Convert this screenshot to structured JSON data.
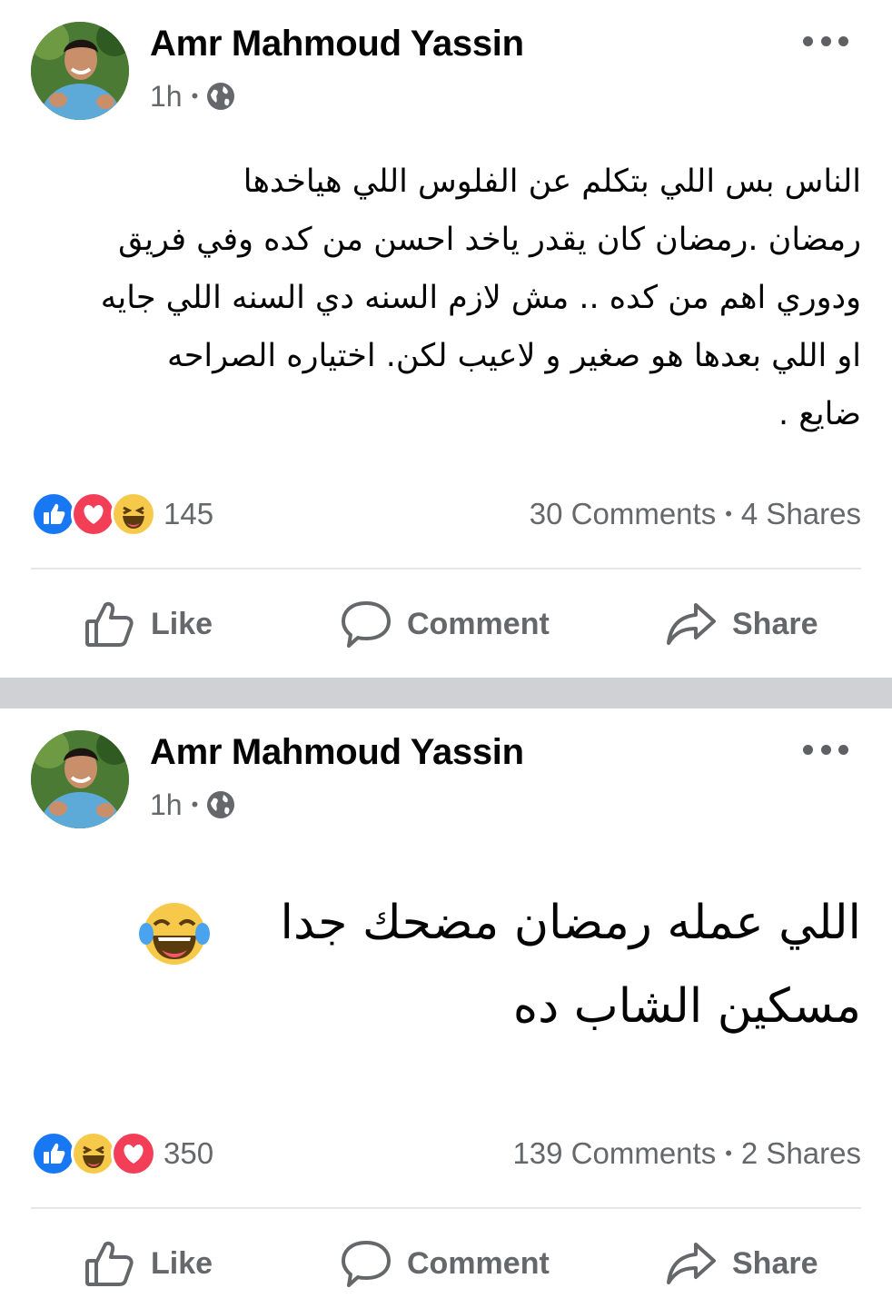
{
  "posts": [
    {
      "author": "Amr Mahmoud Yassin",
      "time": "1h",
      "privacy_icon": "globe-icon",
      "text_lines": [
        "الناس بس اللي بتكلم عن الفلوس اللي هياخدها",
        "رمضان .رمضان كان يقدر ياخد احسن من كده وفي فريق",
        "ودوري اهم من كده .. مش لازم السنه دي السنه اللي جايه",
        "او اللي بعدها هو صغير و لاعيب لكن. اختياره الصراحه",
        "ضايع ."
      ],
      "reactions": [
        "like",
        "love",
        "haha"
      ],
      "reaction_count": "145",
      "comments": "30 Comments",
      "shares": "4 Shares"
    },
    {
      "author": "Amr Mahmoud Yassin",
      "time": "1h",
      "privacy_icon": "globe-icon",
      "text_lines": [
        "اللي عمله رمضان مضحك جدا",
        "مسكين الشاب ده"
      ],
      "emoji": "laughing-tears-emoji",
      "reactions": [
        "like",
        "haha",
        "love"
      ],
      "reaction_count": "350",
      "comments": "139 Comments",
      "shares": "2 Shares"
    }
  ],
  "actions": {
    "like": "Like",
    "comment": "Comment",
    "share": "Share"
  },
  "colors": {
    "like_blue": "#1877f2",
    "love_red": "#f33e58",
    "haha_yellow": "#f7c94a",
    "secondary_text": "#65676b",
    "divider_band": "#cfd1d4"
  }
}
